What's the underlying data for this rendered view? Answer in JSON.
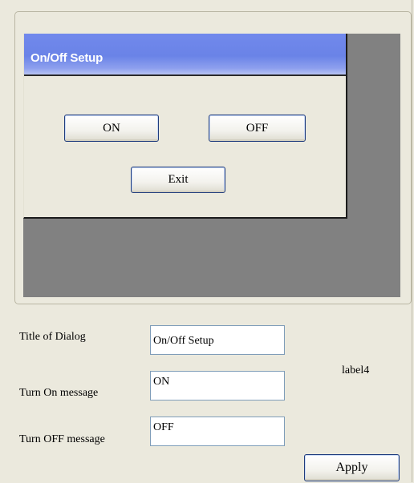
{
  "dialog": {
    "title": "On/Off Setup",
    "on_label": "ON",
    "off_label": "OFF",
    "exit_label": "Exit"
  },
  "form": {
    "title_label": "Title of Dialog",
    "title_value": "On/Off Setup",
    "on_message_label": "Turn On message",
    "on_message_value": "ON",
    "off_message_label": "Turn OFF message",
    "off_message_value": "OFF",
    "side_label": "label4",
    "apply_label": "Apply"
  },
  "colors": {
    "panel_bg": "#ebe9dd",
    "preview_bg": "#818181",
    "titlebar_blue": "#6a83e7",
    "input_border": "#7f9db9",
    "button_border": "#1f3c7d"
  }
}
